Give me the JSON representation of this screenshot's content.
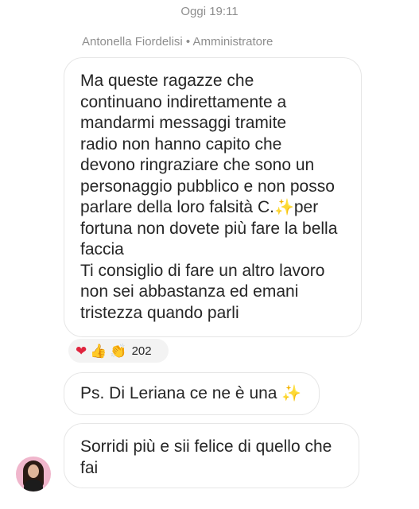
{
  "chat": {
    "timestamp": "Oggi 19:11",
    "sender": "Antonella Fiordelisi • Amministratore",
    "message1": {
      "lines": [
        "Ma queste ragazze che",
        "continuano indirettamente a",
        "mandarmi messaggi tramite",
        "radio non hanno capito che",
        "devono ringraziare che sono un",
        "personaggio pubblico e non posso",
        "parlare della loro falsità C.",
        "fortuna non dovete più fare la bella",
        "faccia",
        "Ti consiglio di fare un altro lavoro",
        "non sei abbastanza ed emani",
        "tristezza quando parli"
      ],
      "line7_suffix": "per",
      "sparkle": "✨"
    },
    "reactions": {
      "heart": "❤",
      "thumbs": "👍",
      "clap": "👏",
      "count": "202"
    },
    "message2": {
      "text": "Ps. Di Leriana ce ne è una ",
      "sparkle": "✨"
    },
    "message3": {
      "lines": [
        "Sorridi più e sii felice di quello che",
        "fai"
      ]
    }
  }
}
